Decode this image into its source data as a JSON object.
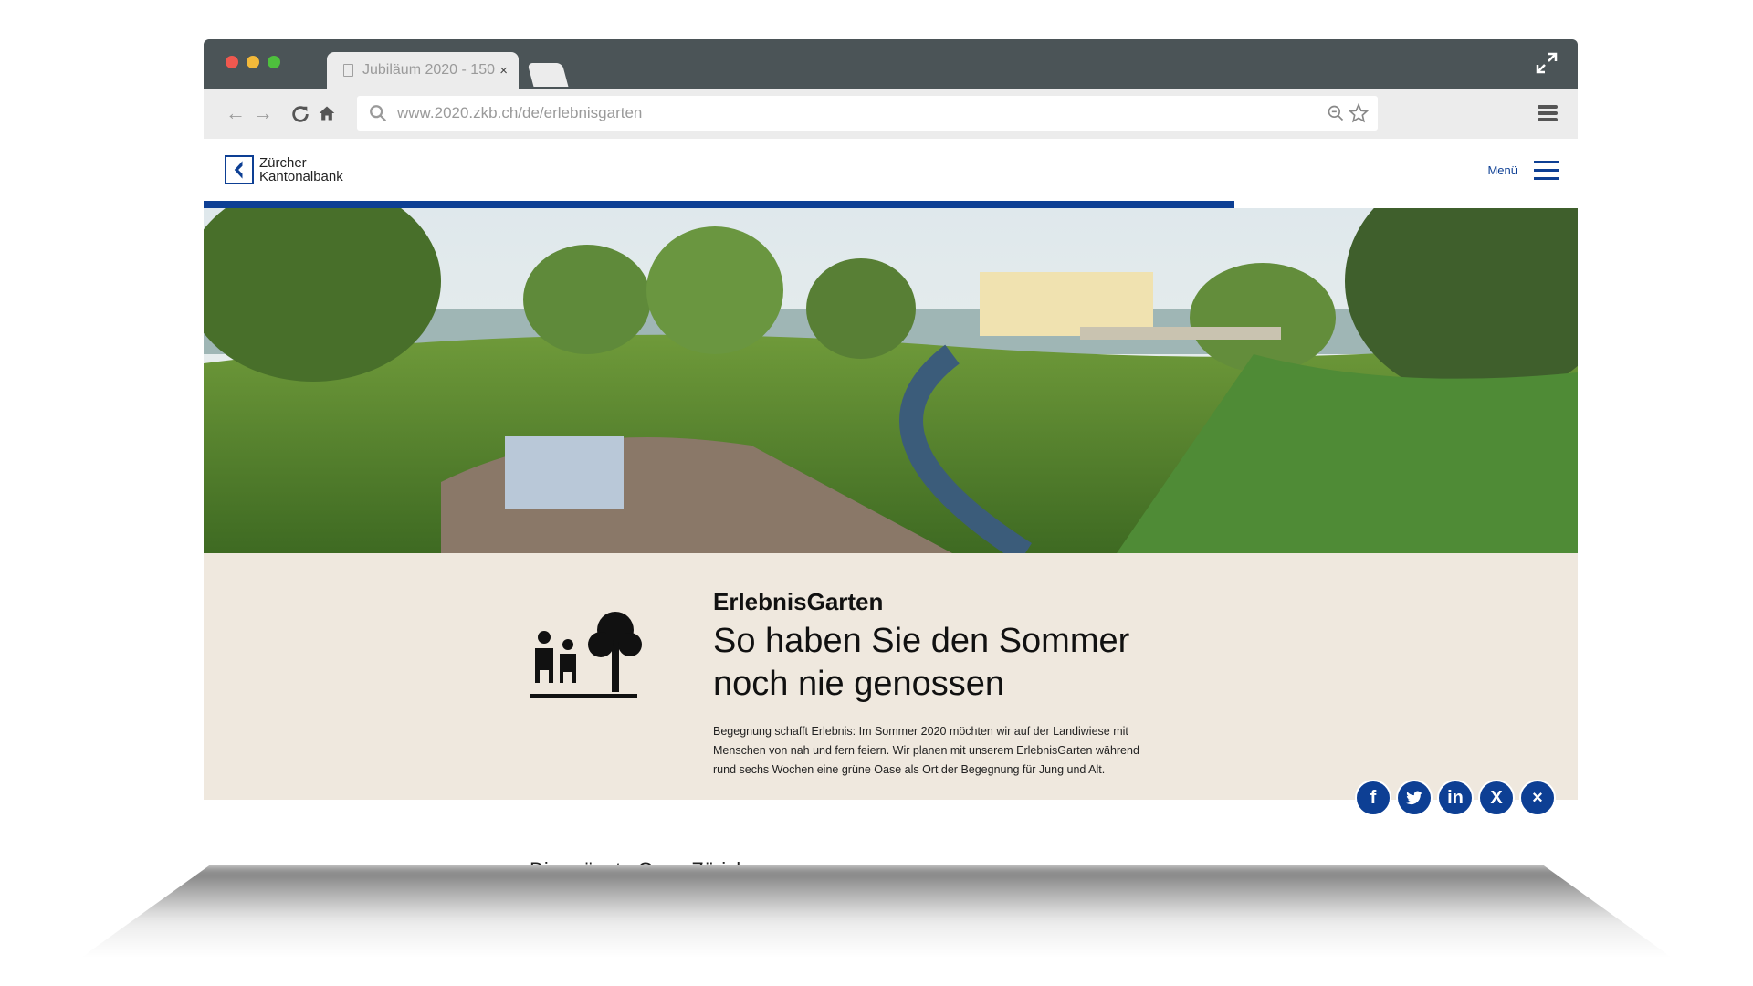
{
  "browser": {
    "tab_title": "Jubiläum 2020 - 150",
    "tab_close": "×",
    "url": "www.2020.zkb.ch/de/erlebnisgarten"
  },
  "site": {
    "logo_line1": "Zürcher",
    "logo_line2": "Kantonalbank",
    "menu_label": "Menü"
  },
  "progress": {
    "fraction": 0.75
  },
  "content": {
    "kicker": "ErlebnisGarten",
    "headline_line1": "So haben Sie den Sommer",
    "headline_line2": "noch nie genossen",
    "body_line1": "Begegnung schafft Erlebnis: Im Sommer 2020 möchten wir auf der Landiwiese mit",
    "body_line2": "Menschen von nah und fern feiern. Wir planen mit unserem ErlebnisGarten während",
    "body_line3": "rund sechs Wochen eine grüne Oase als Ort der Begegnung für Jung und Alt.",
    "teaser": "Die grünste Oase Zürichs"
  },
  "share": {
    "facebook": "f",
    "twitter": "t",
    "linkedin": "in",
    "xing": "X",
    "close": "×"
  },
  "colors": {
    "brand_blue": "#0d3f94",
    "content_bg": "#efe8de",
    "titlebar": "#4b5457"
  }
}
